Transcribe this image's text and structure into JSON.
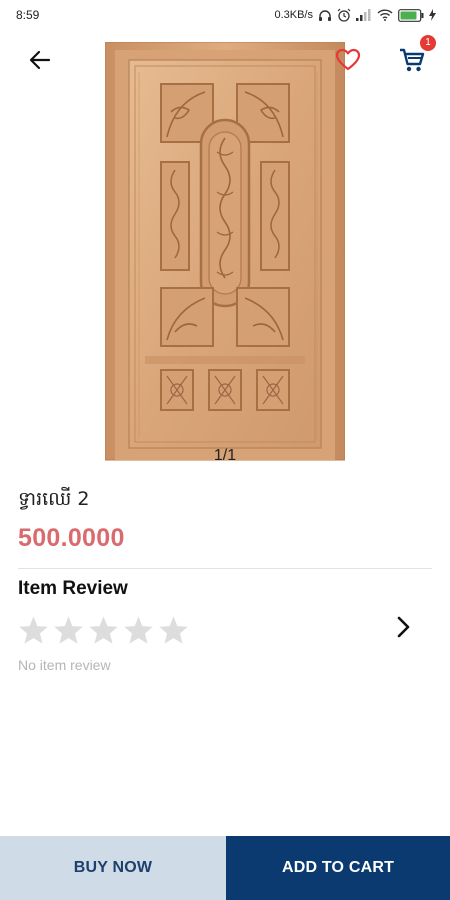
{
  "status_bar": {
    "time": "8:59",
    "network_speed": "0.3KB/s",
    "icons": [
      "headphones-icon",
      "alarm-icon",
      "signal-icon",
      "wifi-icon",
      "battery-icon",
      "charging-icon"
    ]
  },
  "header": {
    "back_icon": "arrow-left-icon",
    "favorite_icon": "heart-outline-icon",
    "cart_icon": "shopping-cart-icon",
    "cart_badge": "1"
  },
  "product": {
    "image": "carved-wooden-door",
    "image_counter": "1/1",
    "title": "ទ្វារឈើ 2",
    "price": "500.0000"
  },
  "review": {
    "title": "Item Review",
    "rating": 0,
    "max_rating": 5,
    "empty_text": "No item review"
  },
  "actions": {
    "buy_now": "BUY NOW",
    "add_to_cart": "ADD TO CART"
  },
  "colors": {
    "price": "#d96b6f",
    "primary": "#0b3a70",
    "secondary_bg": "#cfdbe6",
    "favorite": "#e53935",
    "star_empty": "#dddddd"
  }
}
